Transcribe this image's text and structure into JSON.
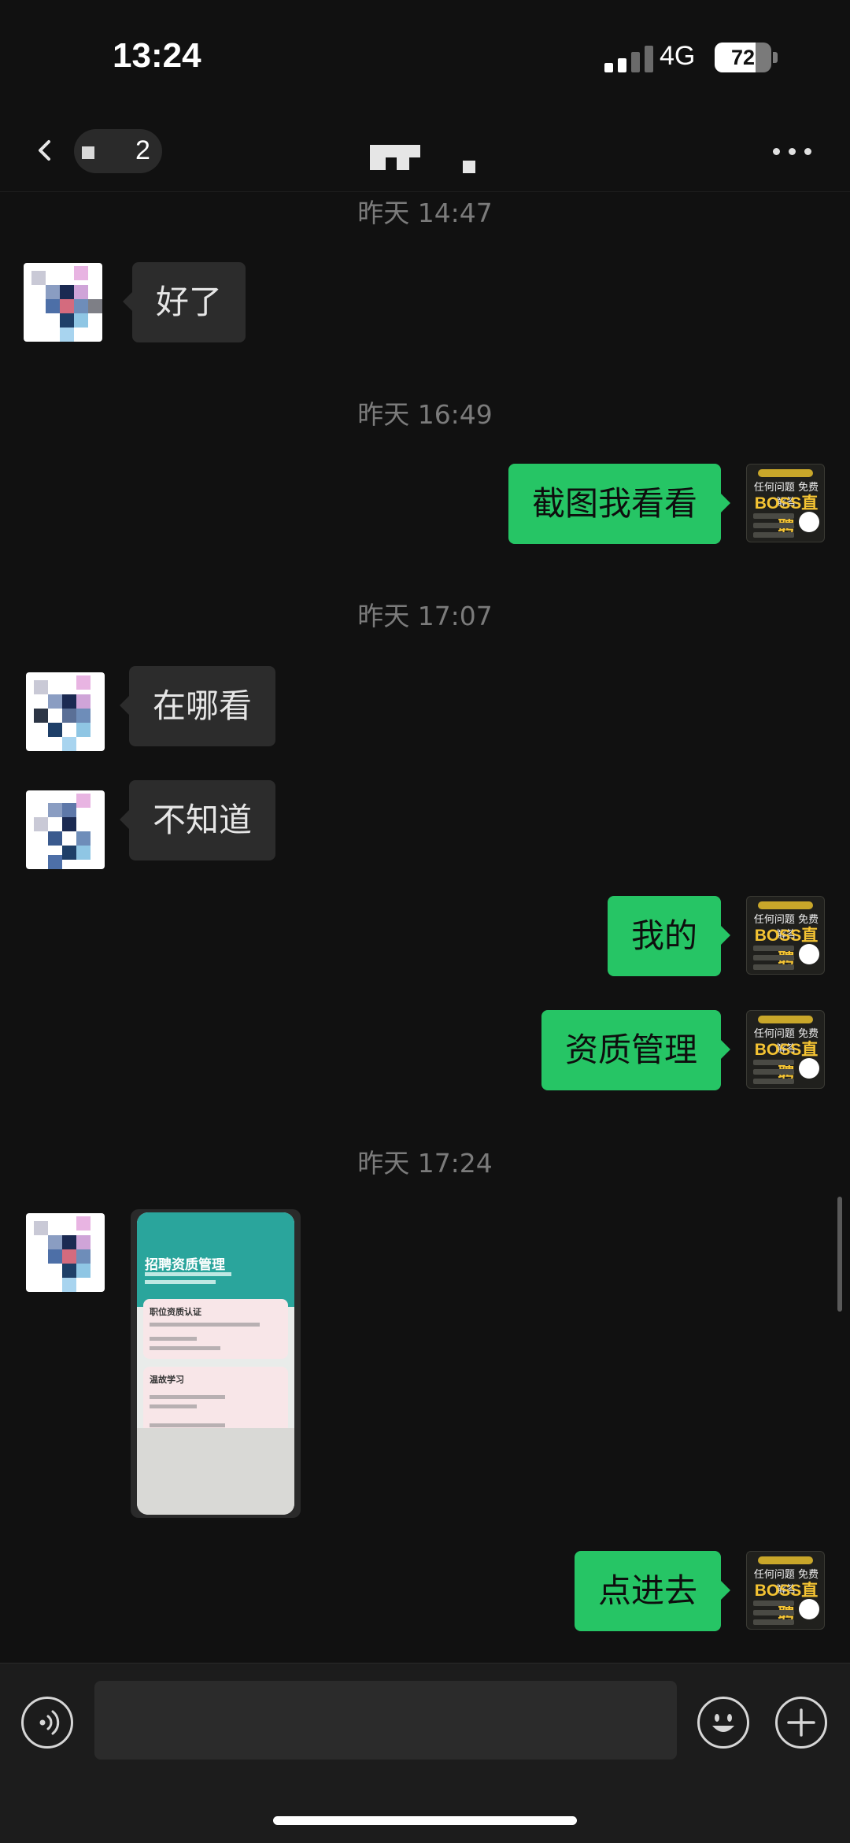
{
  "status_bar": {
    "time": "13:24",
    "network": "4G",
    "battery_level": "72",
    "battery_percent": 72
  },
  "nav": {
    "back_count": "2",
    "back_icon": "chevron-left-icon",
    "more_icon": "ellipsis-icon"
  },
  "timestamps": [
    "昨天 14:47",
    "昨天 16:49",
    "昨天 17:07",
    "昨天 17:24"
  ],
  "messages": [
    {
      "from": "them",
      "text": "好了"
    },
    {
      "from": "me",
      "text": "截图我看看"
    },
    {
      "from": "them",
      "text": "在哪看"
    },
    {
      "from": "them",
      "text": "不知道"
    },
    {
      "from": "me",
      "text": "我的"
    },
    {
      "from": "me",
      "text": "资质管理"
    },
    {
      "from": "them",
      "type": "image"
    },
    {
      "from": "me",
      "text": "点进去"
    }
  ],
  "my_avatar": {
    "line1": "任何问题 免费解答",
    "brand": "BOSS直聘"
  },
  "screenshot_image": {
    "title": "招聘资质管理",
    "card1_title": "职位资质认证",
    "card2_title": "温故学习"
  },
  "input_bar": {
    "voice_icon": "voice-icon",
    "emoji_icon": "emoji-icon",
    "plus_icon": "plus-icon"
  },
  "colors": {
    "background": "#111111",
    "outgoing_bubble": "#26c565",
    "incoming_bubble": "#2c2c2c",
    "timestamp": "#7b7b7b"
  }
}
